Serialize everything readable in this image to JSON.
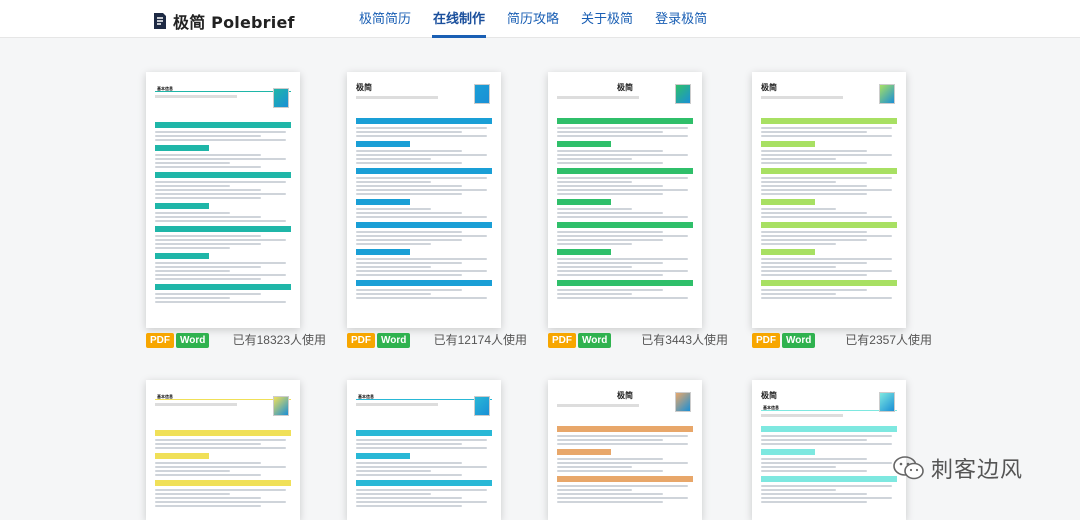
{
  "header": {
    "logo_text": "极简 Polebrief",
    "nav": [
      {
        "label": "极简简历"
      },
      {
        "label": "在线制作"
      },
      {
        "label": "简历攻略"
      },
      {
        "label": "关于极简"
      },
      {
        "label": "登录极简"
      }
    ],
    "active_tab": "在线制作"
  },
  "templates": [
    {
      "formats": [
        "PDF",
        "Word"
      ],
      "usage": "已有18323人使用",
      "accent": "#1fb6a8",
      "title": "基本信息",
      "name": ""
    },
    {
      "formats": [
        "PDF",
        "Word"
      ],
      "usage": "已有12174人使用",
      "accent": "#1a9fd6",
      "title": "",
      "name": "极简"
    },
    {
      "formats": [
        "PDF",
        "Word"
      ],
      "usage": "已有3443人使用",
      "accent": "#2fbf6a",
      "title": "",
      "name": "极简"
    },
    {
      "formats": [
        "PDF",
        "Word"
      ],
      "usage": "已有2357人使用",
      "accent": "#a8e063",
      "title": "",
      "name": "极简"
    },
    {
      "accent": "#f0e058",
      "title": "基本信息",
      "name": ""
    },
    {
      "accent": "#29b8d6",
      "title": "基本信息",
      "name": ""
    },
    {
      "accent": "#e8a76a",
      "title": "",
      "name": "极简"
    },
    {
      "accent": "#7ee8e0",
      "title": "基本信息",
      "name": "极简"
    }
  ],
  "watermark": {
    "text": "刺客边风",
    "icon": "wechat-icon"
  }
}
